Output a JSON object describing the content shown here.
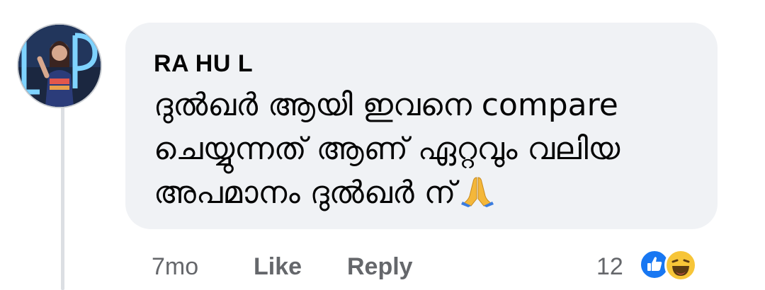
{
  "comment": {
    "author": "RA HU L",
    "text": "ദുൽഖർ ആയി ഇവനെ compare ചെയ്യുന്നത് ആണ് ഏറ്റവും വലിയ അപമാനം ദുൽഖർ ന്",
    "emoji_icon": "folded-hands-icon"
  },
  "actions": {
    "time": "7mo",
    "like_label": "Like",
    "reply_label": "Reply"
  },
  "reactions": {
    "count": "12",
    "icons": [
      "like-reaction-icon",
      "haha-reaction-icon"
    ]
  },
  "colors": {
    "bubble": "#f0f2f5",
    "meta_text": "#65676b",
    "like_blue": "#1877f2",
    "haha_yellow": "#f7c538"
  }
}
